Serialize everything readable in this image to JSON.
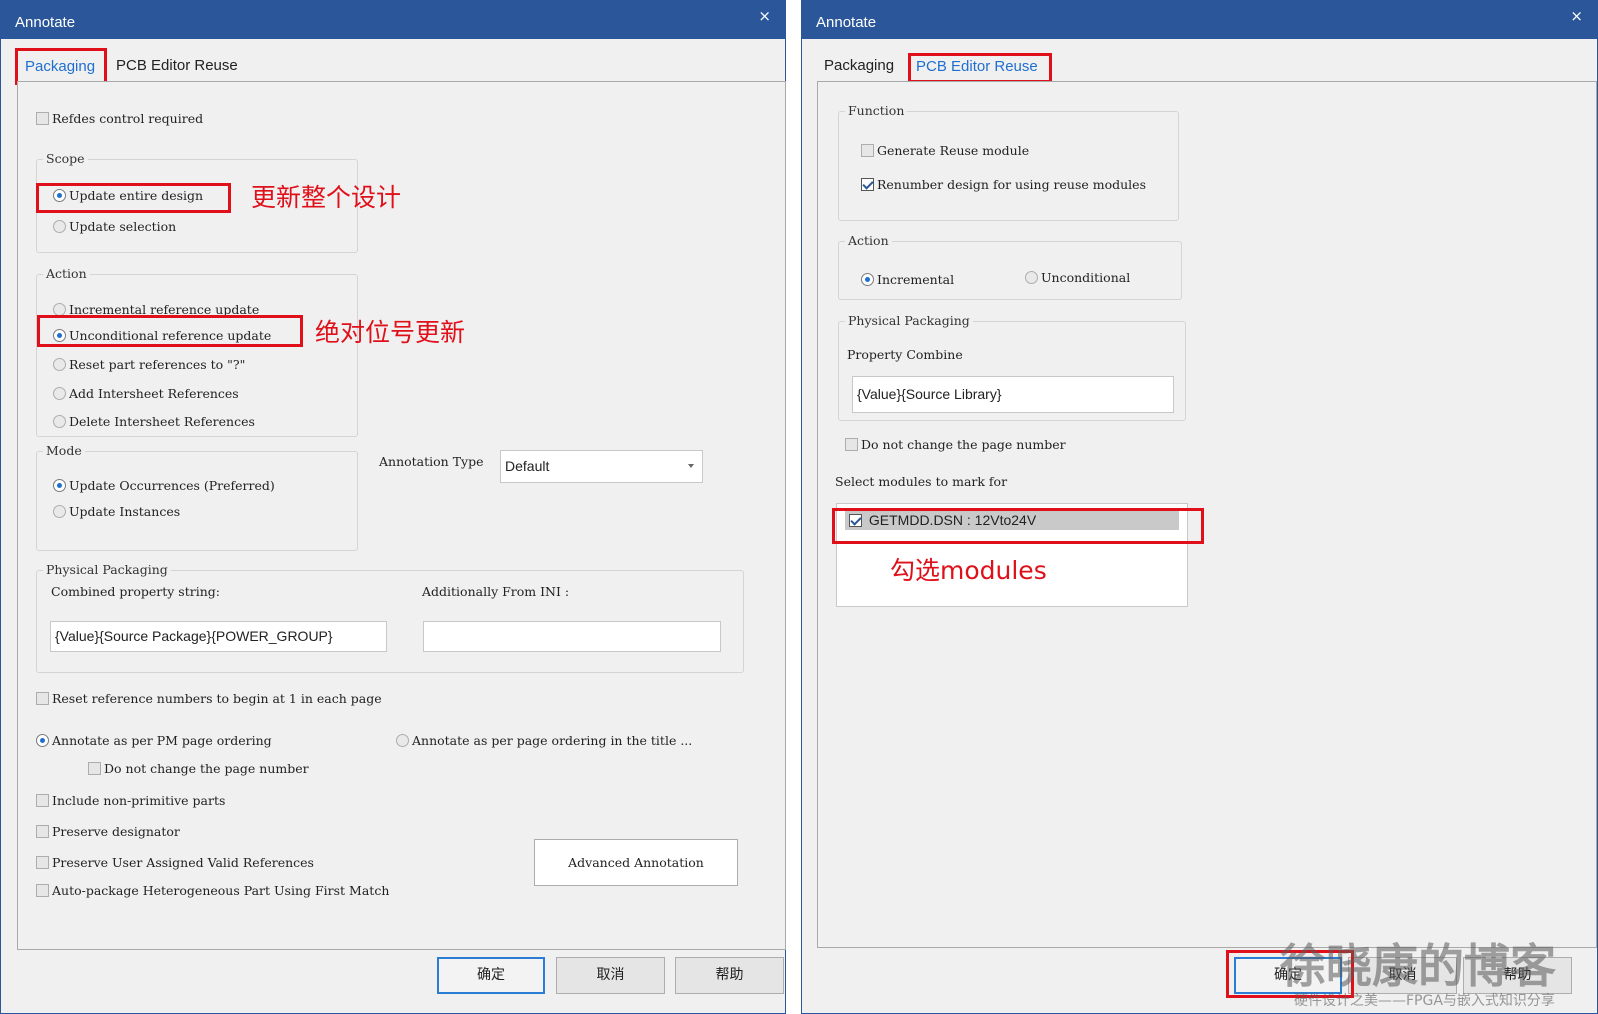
{
  "left": {
    "title": "Annotate",
    "close": "×",
    "tabs": [
      "Packaging",
      "PCB Editor Reuse"
    ],
    "refdes": "Refdes control required",
    "scope": {
      "title": "Scope",
      "opt1": "Update entire design",
      "opt2": "Update selection"
    },
    "action": {
      "title": "Action",
      "opts": [
        "Incremental reference update",
        "Unconditional reference update",
        "Reset part references to \"?\"",
        "Add Intersheet References",
        "Delete Intersheet References"
      ]
    },
    "mode": {
      "title": "Mode",
      "opt1": "Update Occurrences (Preferred)",
      "opt2": "Update Instances"
    },
    "annotation_type": {
      "label": "Annotation Type",
      "value": "Default"
    },
    "physical": {
      "title": "Physical Packaging",
      "combined_label": "Combined property string:",
      "combined_value": "{Value}{Source Package}{POWER_GROUP}",
      "ini_label": "Additionally From INI :",
      "ini_value": ""
    },
    "reset_ref": "Reset reference numbers to begin at 1 in each page",
    "ordering_pm": "Annotate as per PM page ordering",
    "ordering_title": "Annotate as per page ordering in the title ...",
    "no_change_page": "Do not change the page number",
    "include_np": "Include non-primitive parts",
    "preserve_des": "Preserve designator",
    "preserve_user": "Preserve User Assigned Valid References",
    "auto_package": "Auto-package Heterogeneous Part Using First Match",
    "advanced_btn": "Advanced Annotation",
    "ok": "确定",
    "cancel": "取消",
    "help": "帮助"
  },
  "right": {
    "title": "Annotate",
    "close": "×",
    "tabs": [
      "Packaging",
      "PCB Editor Reuse"
    ],
    "function": {
      "title": "Function",
      "opt1": "Generate Reuse module",
      "opt2": "Renumber design for using reuse modules"
    },
    "action": {
      "title": "Action",
      "opt1": "Incremental",
      "opt2": "Unconditional"
    },
    "physical": {
      "title": "Physical Packaging",
      "label": "Property Combine",
      "value": "{Value}{Source Library}"
    },
    "no_change_page": "Do not change the page number",
    "select_label": "Select modules to mark for",
    "module_item": "GETMDD.DSN : 12Vto24V",
    "ok": "确定",
    "cancel": "取消",
    "help": "帮助"
  },
  "annotations": {
    "scope_note": "更新整个设计",
    "action_note": "绝对位号更新",
    "modules_note": "勾选modules"
  },
  "watermark": {
    "main": "徐晓康的博客",
    "sub": "硬件设计之美——FPGA与嵌入式知识分享"
  },
  "colors": {
    "titlebar": "#2b579a",
    "highlight": "#e0101a",
    "active_tab": "#1f6fd1"
  }
}
